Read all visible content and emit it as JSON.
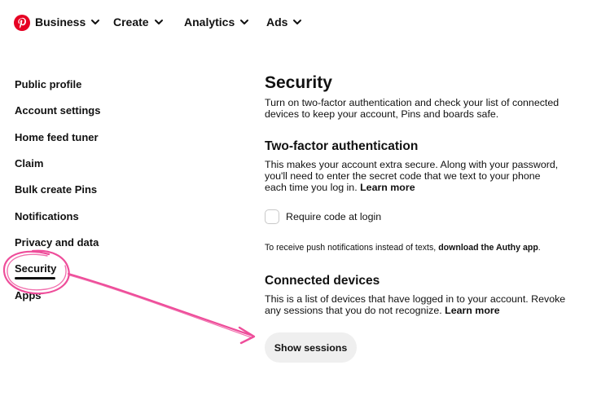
{
  "colors": {
    "brand": "#e60023",
    "annotation": "#ee4d9a",
    "button_bg": "#efefef"
  },
  "nav": {
    "logo_icon": "pinterest-logo",
    "items": [
      {
        "label": "Business"
      },
      {
        "label": "Create"
      },
      {
        "label": "Analytics"
      },
      {
        "label": "Ads"
      }
    ]
  },
  "sidebar": {
    "items": [
      {
        "label": "Public profile"
      },
      {
        "label": "Account settings"
      },
      {
        "label": "Home feed tuner"
      },
      {
        "label": "Claim"
      },
      {
        "label": "Bulk create Pins"
      },
      {
        "label": "Notifications"
      },
      {
        "label": "Privacy and data"
      },
      {
        "label": "Security"
      },
      {
        "label": "Apps"
      }
    ],
    "active": "Security"
  },
  "main": {
    "title": "Security",
    "intro_lines": [
      "Turn on two-factor authentication and check your list of connected",
      "devices to keep your account, Pins and boards safe."
    ],
    "two_factor": {
      "heading": "Two-factor authentication",
      "desc_lines": [
        "This makes your account extra secure. Along with your password,",
        "you'll need to enter the secret code that we text to your phone",
        "each time you log in."
      ],
      "learn_more": "Learn more",
      "checkbox_label": "Require code at login",
      "authy_text": "To receive push notifications instead of texts,",
      "authy_link": "download the Authy app",
      "authy_end": "."
    },
    "devices": {
      "heading": "Connected devices",
      "desc_lines": [
        "This is a list of devices that have logged in to your account. Revoke",
        "any sessions that you do not recognize."
      ],
      "learn_more": "Learn more",
      "button": "Show sessions"
    }
  }
}
